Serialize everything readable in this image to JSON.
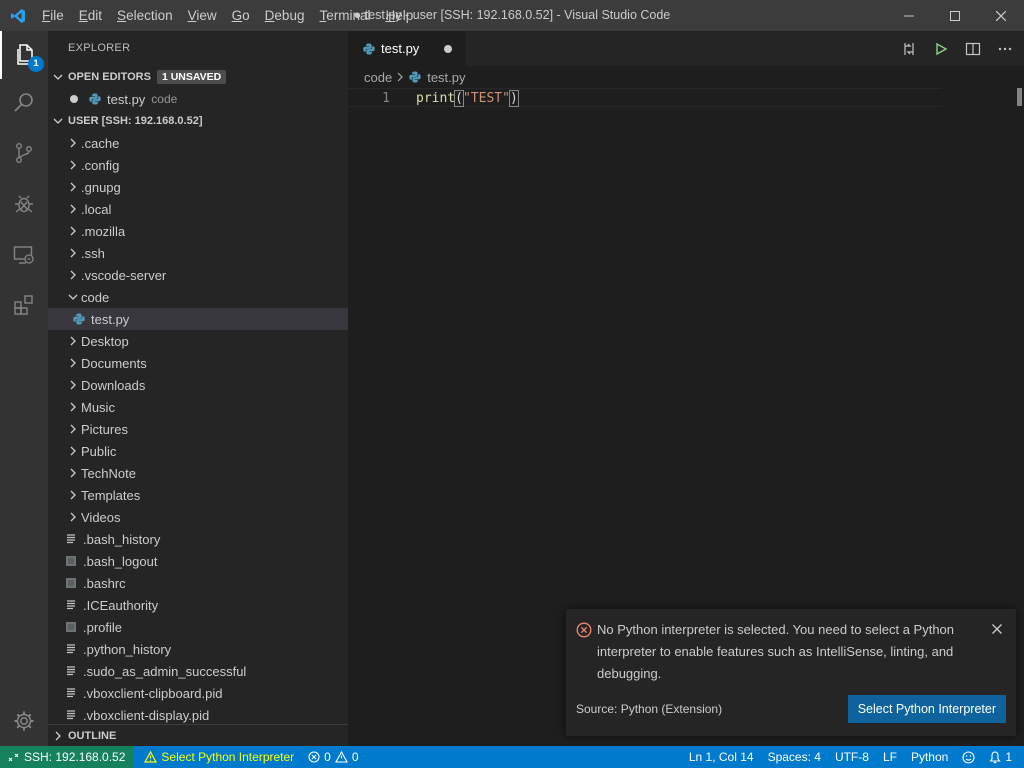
{
  "titlebar": {
    "title": "● test.py - user [SSH: 192.168.0.52] - Visual Studio Code",
    "menu": [
      {
        "first": "F",
        "rest": "ile"
      },
      {
        "first": "E",
        "rest": "dit"
      },
      {
        "first": "S",
        "rest": "election"
      },
      {
        "first": "V",
        "rest": "iew"
      },
      {
        "first": "G",
        "rest": "o"
      },
      {
        "first": "D",
        "rest": "ebug"
      },
      {
        "first": "T",
        "rest": "erminal"
      },
      {
        "first": "H",
        "rest": "elp"
      }
    ]
  },
  "activity": {
    "explorer_badge": "1"
  },
  "sidebar": {
    "title": "EXPLORER",
    "open_editors": {
      "label": "OPEN EDITORS",
      "badge": "1 UNSAVED",
      "items": [
        {
          "name": "test.py",
          "desc": "code"
        }
      ]
    },
    "workspace": {
      "label": "USER [SSH: 192.168.0.52]",
      "folders_top": [
        ".cache",
        ".config",
        ".gnupg",
        ".local",
        ".mozilla",
        ".ssh",
        ".vscode-server"
      ],
      "open_folder": "code",
      "open_folder_file": "test.py",
      "folders_bottom": [
        "Desktop",
        "Documents",
        "Downloads",
        "Music",
        "Pictures",
        "Public",
        "TechNote",
        "Templates",
        "Videos"
      ],
      "files": [
        ".bash_history",
        ".bash_logout",
        ".bashrc",
        ".ICEauthority",
        ".profile",
        ".python_history",
        ".sudo_as_admin_successful",
        ".vboxclient-clipboard.pid",
        ".vboxclient-display.pid"
      ]
    },
    "outline_label": "OUTLINE"
  },
  "editor": {
    "tab_label": "test.py",
    "breadcrumb": {
      "folder": "code",
      "file": "test.py"
    },
    "line_number": "1",
    "code": {
      "fn": "print",
      "open": "(",
      "str": "\"TEST\"",
      "close": ")"
    }
  },
  "notification": {
    "message": "No Python interpreter is selected. You need to select a Python interpreter to enable features such as IntelliSense, linting, and debugging.",
    "source": "Source: Python (Extension)",
    "button": "Select Python Interpreter"
  },
  "statusbar": {
    "remote": "SSH: 192.168.0.52",
    "warning": "Select Python Interpreter",
    "errors": "0",
    "warnings": "0",
    "position": "Ln 1, Col 14",
    "spaces": "Spaces: 4",
    "encoding": "UTF-8",
    "eol": "LF",
    "language": "Python",
    "notifications": "1"
  },
  "colors": {
    "accent": "#007acc",
    "remote": "#16825d",
    "button": "#0e639c",
    "error": "#f48771"
  }
}
